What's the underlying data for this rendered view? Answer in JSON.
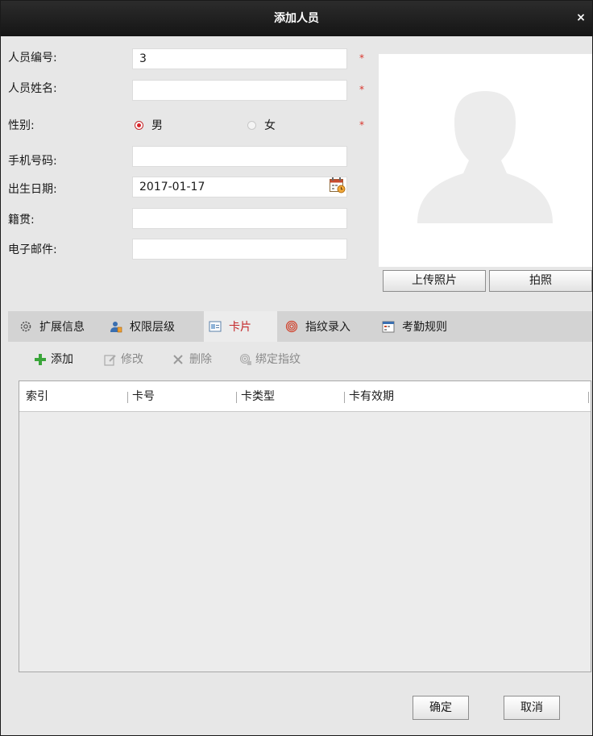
{
  "window": {
    "title": "添加人员",
    "close_icon": "×"
  },
  "form": {
    "id_label": "人员编号:",
    "id_value": "3",
    "name_label": "人员姓名:",
    "name_value": "",
    "gender_label": "性别:",
    "gender_options": [
      "男",
      "女"
    ],
    "gender_selected": "男",
    "phone_label": "手机号码:",
    "phone_value": "",
    "birth_label": "出生日期:",
    "birth_value": "2017-01-17",
    "native_label": "籍贯:",
    "native_value": "",
    "email_label": "电子邮件:",
    "email_value": "",
    "required_mark": "*"
  },
  "photo": {
    "upload_label": "上传照片",
    "capture_label": "拍照"
  },
  "tabs": [
    {
      "label": "扩展信息",
      "icon": "gear-icon",
      "active": false
    },
    {
      "label": "权限层级",
      "icon": "user-key-icon",
      "active": false
    },
    {
      "label": "卡片",
      "icon": "card-icon",
      "active": true
    },
    {
      "label": "指纹录入",
      "icon": "fingerprint-icon",
      "active": false
    },
    {
      "label": "考勤规则",
      "icon": "calendar-icon",
      "active": false
    }
  ],
  "toolbar": {
    "add_label": "添加",
    "edit_label": "修改",
    "delete_label": "删除",
    "bind_label": "绑定指纹"
  },
  "table": {
    "columns": [
      "索引",
      "卡号",
      "卡类型",
      "卡有效期"
    ],
    "rows": []
  },
  "footer": {
    "ok_label": "确定",
    "cancel_label": "取消"
  },
  "colors": {
    "accent": "#d9242a",
    "add_icon": "#3aa53a",
    "titlebar": "#1e1e1e"
  }
}
